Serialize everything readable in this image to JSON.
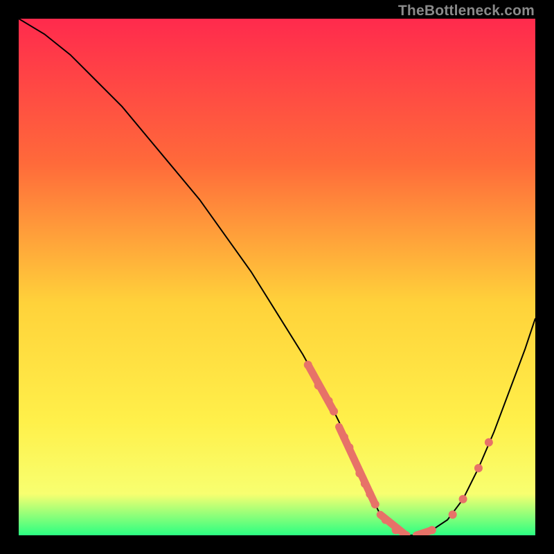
{
  "watermark": "TheBottleneck.com",
  "colors": {
    "gradient_top": "#ff2a4d",
    "gradient_mid1": "#ff6a3a",
    "gradient_mid2": "#ffd23a",
    "gradient_mid3": "#fff04a",
    "gradient_bottom_yellow": "#f8ff70",
    "gradient_bottom_green": "#2bff82",
    "curve": "#000000",
    "marker": "#e77268",
    "background": "#000000"
  },
  "chart_data": {
    "type": "line",
    "title": "",
    "xlabel": "",
    "ylabel": "",
    "xlim": [
      0,
      100
    ],
    "ylim": [
      0,
      100
    ],
    "grid": false,
    "legend": false,
    "series": [
      {
        "name": "bottleneck-curve",
        "x": [
          0,
          5,
          10,
          15,
          20,
          25,
          30,
          35,
          40,
          45,
          50,
          55,
          60,
          62,
          65,
          68,
          70,
          72,
          75,
          78,
          80,
          83,
          86,
          89,
          92,
          95,
          98,
          100
        ],
        "y": [
          100,
          97,
          93,
          88,
          83,
          77,
          71,
          65,
          58,
          51,
          43,
          35,
          26,
          22,
          15,
          8,
          4,
          2,
          0,
          0,
          1,
          3,
          7,
          13,
          20,
          28,
          36,
          42
        ]
      }
    ],
    "markers": [
      {
        "x": 56,
        "y": 33
      },
      {
        "x": 58,
        "y": 29
      },
      {
        "x": 60,
        "y": 26
      },
      {
        "x": 61,
        "y": 24
      },
      {
        "x": 63,
        "y": 19
      },
      {
        "x": 64,
        "y": 17
      },
      {
        "x": 66,
        "y": 12
      },
      {
        "x": 67,
        "y": 10
      },
      {
        "x": 68,
        "y": 8
      },
      {
        "x": 69,
        "y": 6
      },
      {
        "x": 71,
        "y": 3
      },
      {
        "x": 73,
        "y": 1
      },
      {
        "x": 75,
        "y": 0
      },
      {
        "x": 78,
        "y": 0
      },
      {
        "x": 80,
        "y": 1
      },
      {
        "x": 84,
        "y": 4
      },
      {
        "x": 86,
        "y": 7
      },
      {
        "x": 89,
        "y": 13
      },
      {
        "x": 91,
        "y": 18
      }
    ],
    "marker_segments": [
      {
        "x1": 56,
        "y1": 33,
        "x2": 61,
        "y2": 24
      },
      {
        "x1": 62,
        "y1": 21,
        "x2": 69,
        "y2": 6
      },
      {
        "x1": 70,
        "y1": 4,
        "x2": 75,
        "y2": 0
      },
      {
        "x1": 77,
        "y1": 0,
        "x2": 80,
        "y2": 1
      }
    ]
  }
}
